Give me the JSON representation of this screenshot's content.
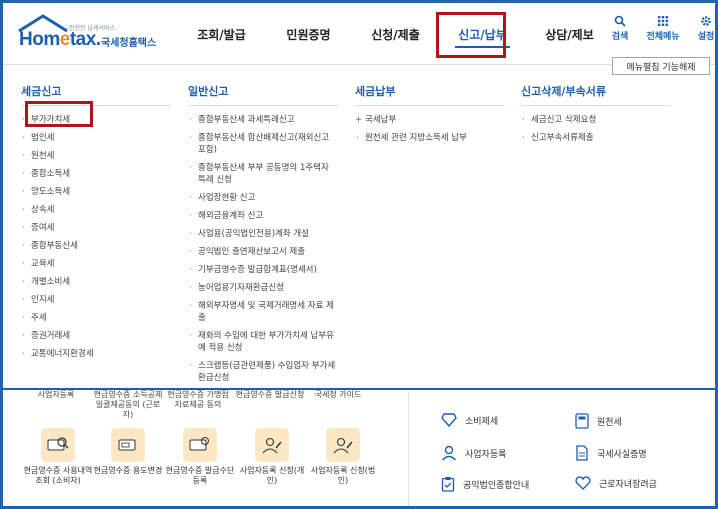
{
  "header": {
    "logo_slogan": "안전한 납세서비스",
    "logo_text_a": "Hom",
    "logo_text_e": "e",
    "logo_text_b": "tax.",
    "logo_subtitle": "국세청홈택스"
  },
  "nav": [
    {
      "label": "조회/발급"
    },
    {
      "label": "민원증명"
    },
    {
      "label": "신청/제출"
    },
    {
      "label": "신고/납부"
    },
    {
      "label": "상담/제보"
    }
  ],
  "tools": [
    {
      "label": "검색",
      "icon": "search-icon"
    },
    {
      "label": "전체메뉴",
      "icon": "grid-icon"
    },
    {
      "label": "설정",
      "icon": "gear-icon"
    }
  ],
  "mega": {
    "unfix_label": "메뉴펼침 기능해제",
    "columns": [
      {
        "title": "세금신고",
        "items": [
          "부가가치세",
          "법인세",
          "원천세",
          "종합소득세",
          "양도소득세",
          "상속세",
          "증여세",
          "종합부동산세",
          "교육세",
          "개별소비세",
          "인지세",
          "주세",
          "증권거래세",
          "교통에너지환경세"
        ]
      },
      {
        "title": "일반신고",
        "items": [
          "종합부동산세 과세특례신고",
          "종합부동산세 합산배제신고(재외신고 포함)",
          "종합부동산세 부부 공동명의 1주택자 특례 신청",
          "사업장현황 신고",
          "해외금융계좌 신고",
          "사업용(공익법인전용)계좌 개설",
          "공익법인 출연재산보고서 제출",
          "기부금영수증 발급합계표(명세서)",
          "농어업용기자재환급신청",
          "해외부자명세 및 국제거래명세 자료 제출",
          "재화의 수입에 대한 부가가치세 납부유예 적용 신청",
          "스크랩등(금관련제품) 수입업자 부가세 환급신청"
        ]
      },
      {
        "title": "세금납부",
        "items": [
          "국세납부",
          "원천세 관련 지방소득세 납부"
        ]
      },
      {
        "title": "신고삭제/부속서류",
        "items": [
          "세금신고 삭제요청",
          "신고부속서류제출"
        ]
      }
    ]
  },
  "bottom": {
    "cut_labels": [
      "사업자등록",
      "현금영수증 소득공제 일괄제공동의 (근로자)",
      "현금영수증 가맹점 자료제공 동의",
      "현금영수증 발급신청",
      "국세청 가이드"
    ],
    "quick": [
      {
        "label": "현금영수증 사용내역조회 (소비자)"
      },
      {
        "label": "현금영수증 용도변경"
      },
      {
        "label": "현금영수증 발급수단 등록"
      },
      {
        "label": "사업자등록 신청(개인)"
      },
      {
        "label": "사업자등록 신청(법인)"
      }
    ],
    "services": [
      {
        "label": "소비제세",
        "icon": "diamond-icon"
      },
      {
        "label": "원천세",
        "icon": "calculator-icon"
      },
      {
        "label": "사업자등록",
        "icon": "person-icon"
      },
      {
        "label": "국세사실증명",
        "icon": "document-icon"
      },
      {
        "label": "공익법인종합안내",
        "icon": "clipboard-icon"
      },
      {
        "label": "근로자녀장려금",
        "icon": "heart-icon"
      }
    ]
  },
  "colors": {
    "brand": "#1c5fb0",
    "accent": "#f08c1e",
    "highlight": "#b3141b"
  }
}
